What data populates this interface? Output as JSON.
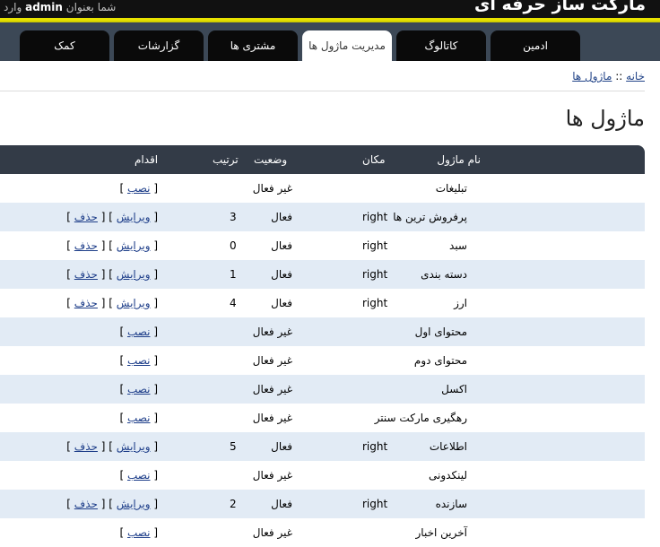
{
  "header": {
    "site_title": "مارکت ساز حرفه ای",
    "login_prefix": "شما بعنوان",
    "username": "admin",
    "login_suffix": "وارد"
  },
  "tabs": [
    {
      "label": "ادمین",
      "active": false
    },
    {
      "label": "کاتالوگ",
      "active": false
    },
    {
      "label": "مدیریت ماژول ها",
      "active": true
    },
    {
      "label": "مشتری ها",
      "active": false
    },
    {
      "label": "گزارشات",
      "active": false
    },
    {
      "label": "کمک",
      "active": false
    }
  ],
  "breadcrumb": {
    "home": "خانه",
    "separator": "::",
    "current": "ماژول ها"
  },
  "page_title": "ماژول ها",
  "table": {
    "headers": {
      "name": "نام ماژول",
      "position": "مکان",
      "status": "وضعیت",
      "order": "ترتیب",
      "action": "اقدام"
    },
    "action_labels": {
      "install": "نصب",
      "edit": "ویرایش",
      "delete": "حذف"
    },
    "rows": [
      {
        "name": "تبلیغات",
        "position": "",
        "status": "غیر فعال",
        "order": "",
        "installed": false
      },
      {
        "name": "پرفروش ترین ها",
        "position": "right",
        "status": "فعال",
        "order": "3",
        "installed": true
      },
      {
        "name": "سبد",
        "position": "right",
        "status": "فعال",
        "order": "0",
        "installed": true
      },
      {
        "name": "دسته بندی",
        "position": "right",
        "status": "فعال",
        "order": "1",
        "installed": true
      },
      {
        "name": "ارز",
        "position": "right",
        "status": "فعال",
        "order": "4",
        "installed": true
      },
      {
        "name": "محتوای اول",
        "position": "",
        "status": "غیر فعال",
        "order": "",
        "installed": false
      },
      {
        "name": "محتوای دوم",
        "position": "",
        "status": "غیر فعال",
        "order": "",
        "installed": false
      },
      {
        "name": "اکسل",
        "position": "",
        "status": "غیر فعال",
        "order": "",
        "installed": false
      },
      {
        "name": "رهگیری مارکت سنتر",
        "position": "",
        "status": "غیر فعال",
        "order": "",
        "installed": false
      },
      {
        "name": "اطلاعات",
        "position": "right",
        "status": "فعال",
        "order": "5",
        "installed": true
      },
      {
        "name": "لینکدونی",
        "position": "",
        "status": "غیر فعال",
        "order": "",
        "installed": false
      },
      {
        "name": "سازنده",
        "position": "right",
        "status": "فعال",
        "order": "2",
        "installed": true
      },
      {
        "name": "آخرین اخبار",
        "position": "",
        "status": "غیر فعال",
        "order": "",
        "installed": false
      }
    ]
  }
}
